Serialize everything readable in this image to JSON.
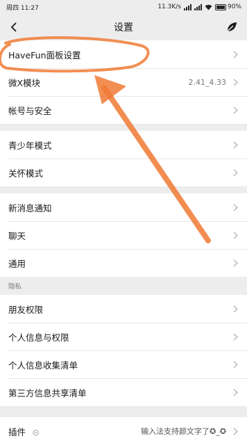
{
  "status": {
    "day_time": "周四 11:27",
    "network_speed": "11.3K/s",
    "battery": "90%",
    "icons": [
      "signal-icon",
      "signal-icon",
      "wifi-icon",
      "battery-icon"
    ]
  },
  "nav": {
    "title": "设置",
    "back_icon": "chevron-left-icon",
    "right_icon": "leaf-icon"
  },
  "group1": [
    {
      "label": "HaveFun面板设置"
    },
    {
      "label": "微X模块",
      "value": "2.41_4.33"
    },
    {
      "label": "帐号与安全"
    }
  ],
  "group2": [
    {
      "label": "青少年模式"
    },
    {
      "label": "关怀模式"
    }
  ],
  "group3": [
    {
      "label": "新消息通知"
    },
    {
      "label": "聊天"
    },
    {
      "label": "通用"
    }
  ],
  "privacy_header": "隐私",
  "group4": [
    {
      "label": "朋友权限"
    },
    {
      "label": "个人信息与权限"
    },
    {
      "label": "个人信息收集清单"
    },
    {
      "label": "第三方信息共享清单"
    }
  ],
  "group5": [
    {
      "label": "插件",
      "value": "输入法支持颜文字了✪_✪"
    }
  ],
  "colors": {
    "background": "#ededed",
    "annotation": "#f07a35"
  }
}
